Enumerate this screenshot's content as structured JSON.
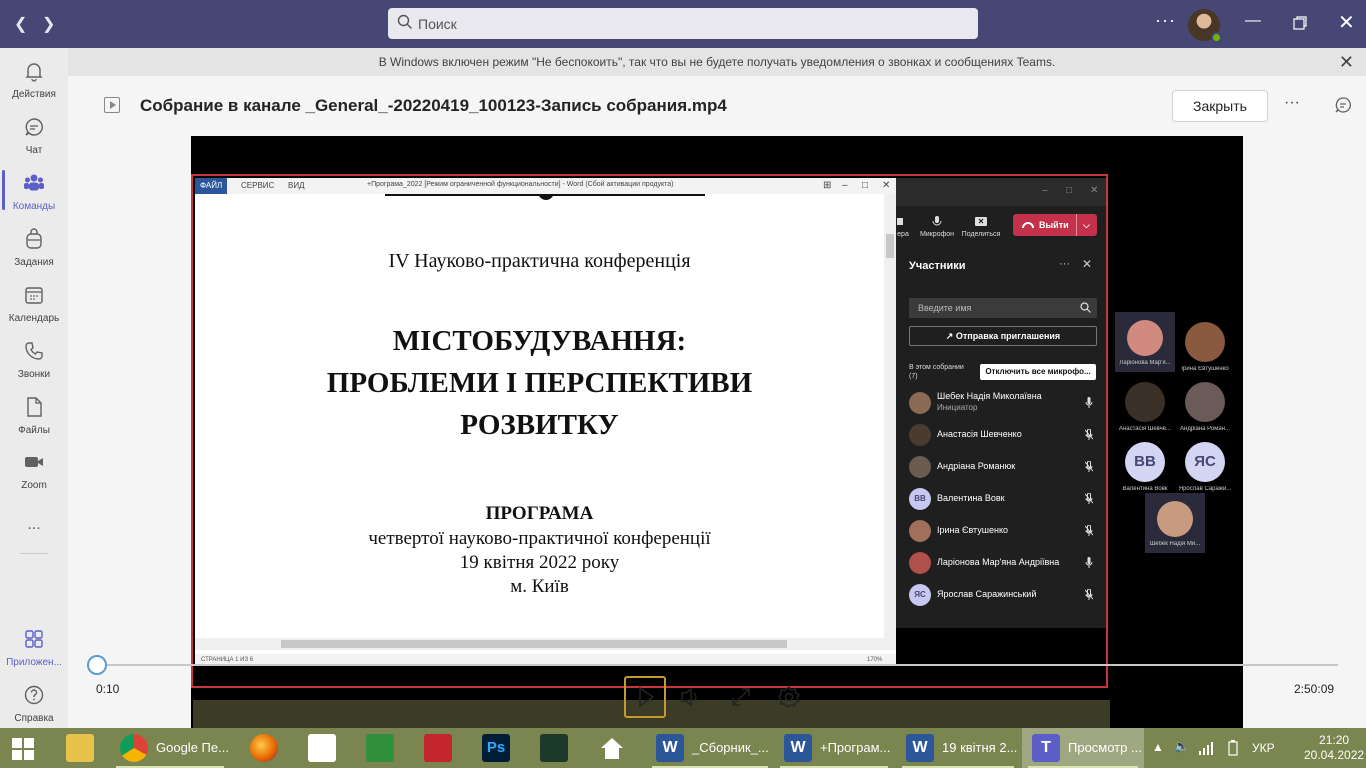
{
  "titlebar": {
    "search_placeholder": "Поиск"
  },
  "rail": [
    {
      "label": "Действия"
    },
    {
      "label": "Чат"
    },
    {
      "label": "Команды"
    },
    {
      "label": "Задания"
    },
    {
      "label": "Календарь"
    },
    {
      "label": "Звонки"
    },
    {
      "label": "Файлы"
    },
    {
      "label": "Zoom"
    },
    {
      "label": "..."
    },
    {
      "label": "Приложен..."
    },
    {
      "label": "Справка"
    }
  ],
  "banner": {
    "text": "В Windows включен режим \"Не беспокоить\", так что вы не будете получать уведомления о звонках и сообщениях Teams."
  },
  "file": {
    "title": "Собрание в канале _General_-20220419_100123-Запись собрания.mp4",
    "close_label": "Закрыть"
  },
  "word": {
    "tab_file": "ФАЙЛ",
    "tab_service": "СЕРВИС",
    "tab_view": "ВИД",
    "window_title": "+Програма_2022 [Режим ограниченной функциональности] - Word (Сбой активации продукта)",
    "status": "СТРАНИЦА 1 ИЗ 6",
    "zoom": "170%",
    "doc": {
      "line1": "IV Науково-практична конференція",
      "heading1": "МІСТОБУДУВАННЯ:",
      "heading2": "ПРОБЛЕМИ І ПЕРСПЕКТИВИ",
      "heading3": "РОЗВИТКУ",
      "program": "ПРОГРАМА",
      "line2": "четвертої науково-практичної конференції",
      "line3": "19 квітня 2022 року",
      "line4": "м. Київ"
    }
  },
  "teams_mini": {
    "camera": "ера",
    "mic": "Микрофон",
    "share": "Поделиться",
    "leave": "Выйти",
    "title": "Участники",
    "search_placeholder": "Введите имя",
    "invite": "Отправка приглашения",
    "in_meeting": "В этом собрании",
    "count": "(7)",
    "mute_all": "Отключить все микрофо...",
    "participants": [
      {
        "name": "Шебек Надія Миколаївна",
        "role": "Инициатор",
        "mic": "on"
      },
      {
        "name": "Анастасія Шевченко",
        "mic": "off"
      },
      {
        "name": "Андріана Романюк",
        "mic": "off"
      },
      {
        "name": "Валентина Вовк",
        "initials": "ВВ",
        "mic": "off"
      },
      {
        "name": "Ірина Євтушенко",
        "mic": "off"
      },
      {
        "name": "Ларіонова Мар'яна Андріївна",
        "mic": "on"
      },
      {
        "name": "Ярослав Саражинський",
        "initials": "ЯС",
        "mic": "off"
      }
    ]
  },
  "thumbs": [
    {
      "label": "Ларіонова Мар'я..."
    },
    {
      "label": "Ірина Євтушенко"
    },
    {
      "label": "Анастасія Шевче..."
    },
    {
      "label": "Андріана Роман..."
    },
    {
      "label": "Валентина Вовк",
      "initials": "ВВ"
    },
    {
      "label": "Ярослав Саражи...",
      "initials": "ЯС"
    },
    {
      "label": "Шебек Надія Ми..."
    }
  ],
  "player": {
    "current": "0:10",
    "total": "2:50:09",
    "progress_fraction": 0.001
  },
  "taskbar": [
    {
      "label": "Google Пе..."
    },
    {
      "label": "_Сборник_..."
    },
    {
      "label": "+Програм..."
    },
    {
      "label": "19 квітня 2..."
    },
    {
      "label": "Просмотр ..."
    }
  ],
  "tray": {
    "lang": "УКР",
    "time": "21:20",
    "date": "20.04.2022"
  }
}
